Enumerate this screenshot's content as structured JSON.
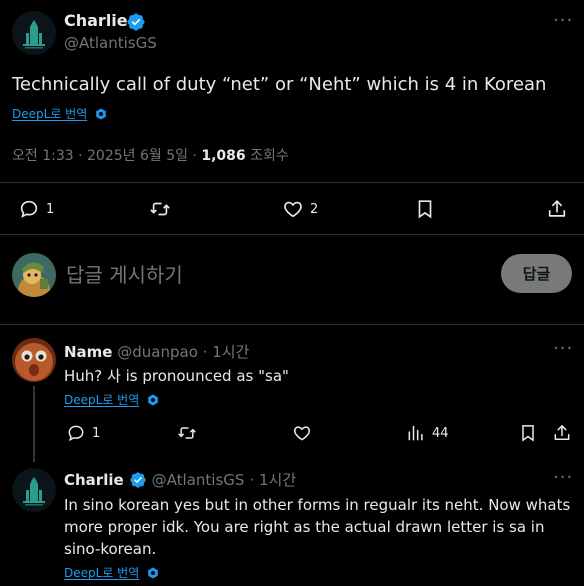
{
  "colors": {
    "background": "#000000",
    "text": "#e7e9ea",
    "muted": "#71767b",
    "link": "#1d9bf0",
    "verified": "#1d9bf0",
    "divider": "#2f3336",
    "reply_button_bg": "#787a7a"
  },
  "main_tweet": {
    "author_name": "Charlie",
    "handle": "@AtlantisGS",
    "text": "Technically call of duty “net” or “Neht” which is 4 in Korean",
    "translate_label": "DeepL로 번역",
    "timestamp": "오전 1:33 · 2025년 6월 5일 · ",
    "views_count": "1,086",
    "views_label": "조회수",
    "replies_count": "1",
    "likes_count": "2",
    "icons": [
      "reply-icon",
      "retweet-icon",
      "like-icon",
      "bookmark-icon",
      "share-icon",
      "more-icon",
      "verified-icon"
    ]
  },
  "composer": {
    "placeholder": "답글 게시하기",
    "submit_label": "답글"
  },
  "replies": [
    {
      "author_name": "Name",
      "handle": "@duanpao",
      "time": "· 1시간",
      "text": "Huh? 사 is pronounced as \"sa\"",
      "translate_label": "DeepL로 번역",
      "replies_count": "1",
      "views_count": "44"
    },
    {
      "author_name": "Charlie",
      "handle": "@AtlantisGS",
      "time": "· 1시간",
      "text": "In sino korean yes but in other forms in regualr its neht. Now whats more proper idk. You are right as the actual drawn letter is sa in sino-korean.",
      "translate_label": "DeepL로 번역"
    }
  ]
}
